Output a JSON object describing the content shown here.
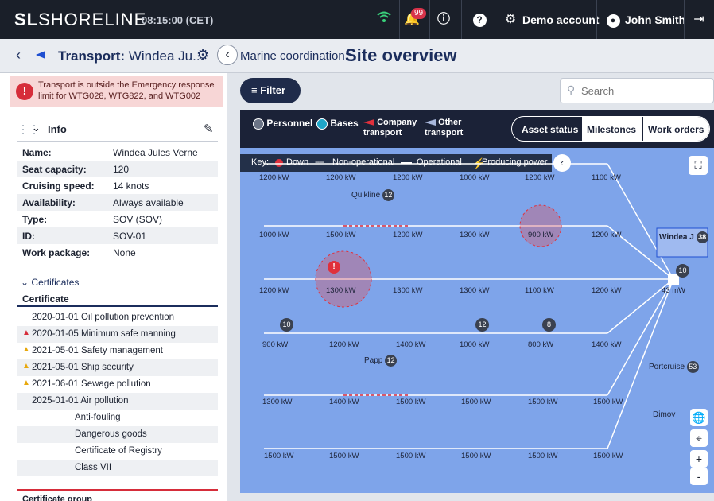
{
  "topbar": {
    "logo_mark": "SL",
    "logo_text": "SHORELINE",
    "clock": "08:15:00 (CET)",
    "notifications_count": "99",
    "account_label": "Demo account",
    "user_name": "John Smith"
  },
  "subbar": {
    "back_label": "Transport:",
    "transport_name": "Windea Ju...",
    "section_prefix": "Marine coordination:",
    "section_title": "Site overview"
  },
  "warning": {
    "text": "Transport is outside the Emergency response limit for WTG028, WTG822, and WTG002"
  },
  "info": {
    "title": "Info",
    "rows": [
      {
        "k": "Name:",
        "v": "Windea Jules Verne"
      },
      {
        "k": "Seat capacity:",
        "v": "120"
      },
      {
        "k": "Cruising speed:",
        "v": "14 knots"
      },
      {
        "k": "Availability:",
        "v": "Always available"
      },
      {
        "k": "Type:",
        "v": "SOV (SOV)"
      },
      {
        "k": "ID:",
        "v": "SOV-01"
      },
      {
        "k": "Work package:",
        "v": "None"
      }
    ]
  },
  "certificates": {
    "title": "Certificates",
    "column_header": "Certificate",
    "rows": [
      "2020-01-01 Oil pollution prevention",
      "2020-01-05 Minimum safe manning",
      "2021-05-01 Safety management",
      "2021-05-01 Ship security",
      "2021-06-01 Sewage pollution",
      "2025-01-01 Air pollution",
      "Anti-fouling",
      "Dangerous goods",
      "Certificate of Registry",
      "Class VII"
    ],
    "group_header": "Certificate group"
  },
  "toolbar": {
    "filter_label": "Filter",
    "search_placeholder": "Search"
  },
  "map": {
    "layers": [
      "Personnel",
      "Bases",
      "Company transport",
      "Other transport"
    ],
    "tabs": [
      "Asset status",
      "Milestones",
      "Work orders"
    ],
    "legend": {
      "key": "Key:",
      "down": "Down",
      "non_operational": "Non-operational",
      "operational": "Operational",
      "producing": "Producing power"
    },
    "rows": [
      [
        "1200 kW",
        "1200 kW",
        "1200 kW",
        "1000 kW",
        "1200 kW",
        "1100 kW"
      ],
      [
        "1000 kW",
        "1500 kW",
        "1200 kW",
        "1300 kW",
        "900 kW",
        "1200 kW"
      ],
      [
        "1200 kW",
        "1300 kW",
        "1300 kW",
        "1300 kW",
        "1100 kW",
        "1200 kW"
      ],
      [
        "900 kW",
        "1200 kW",
        "1400 kW",
        "1000 kW",
        "800 kW",
        "1400 kW"
      ],
      [
        "1300 kW",
        "1400 kW",
        "1500 kW",
        "1500 kW",
        "1500 kW",
        "1500 kW"
      ],
      [
        "1500 kW",
        "1500 kW",
        "1500 kW",
        "1500 kW",
        "1500 kW",
        "1500 kW"
      ]
    ],
    "substation_label": "43 mW",
    "vessels": [
      {
        "name": "Quikline",
        "count": "12"
      },
      {
        "name": "Papp",
        "count": "12"
      },
      {
        "name": "Windea J",
        "count": "38"
      },
      {
        "name": "Portcruise",
        "count": "53"
      },
      {
        "name": "Dimov",
        "count": ""
      }
    ],
    "cluster_counts": [
      "10",
      "12",
      "8",
      "10"
    ],
    "zoom_in": "+",
    "zoom_out": "-"
  }
}
